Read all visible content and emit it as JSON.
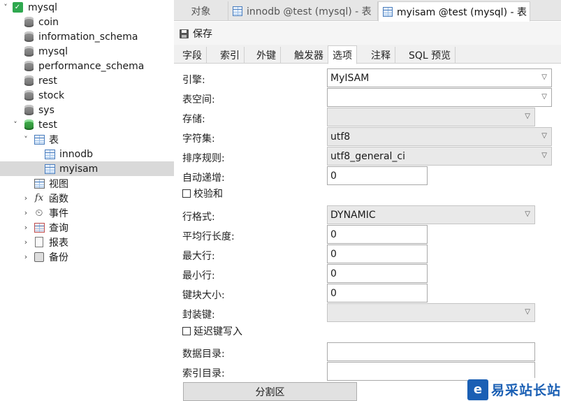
{
  "sidebar": {
    "root": {
      "label": "mysql"
    },
    "dbs": [
      "coin",
      "information_schema",
      "mysql",
      "performance_schema",
      "rest",
      "stock",
      "sys"
    ],
    "test": {
      "label": "test",
      "tables_label": "表",
      "tables": [
        "innodb",
        "myisam"
      ],
      "views_label": "视图",
      "functions_label": "函数",
      "events_label": "事件",
      "queries_label": "查询",
      "reports_label": "报表",
      "backups_label": "备份"
    }
  },
  "doc_tabs": [
    {
      "label": "对象"
    },
    {
      "label": "innodb @test (mysql) - 表"
    },
    {
      "label": "myisam @test (mysql) - 表"
    }
  ],
  "toolbar": {
    "save_label": "保存"
  },
  "sub_tabs": [
    "字段",
    "索引",
    "外键",
    "触发器",
    "选项",
    "注释",
    "SQL 预览"
  ],
  "form": {
    "engine_label": "引擎:",
    "engine_value": "MyISAM",
    "tablespace_label": "表空间:",
    "tablespace_value": "",
    "storage_label": "存储:",
    "storage_value": "",
    "charset_label": "字符集:",
    "charset_value": "utf8",
    "collation_label": "排序规则:",
    "collation_value": "utf8_general_ci",
    "auto_inc_label": "自动递增:",
    "auto_inc_value": "0",
    "checksum_label": "校验和",
    "row_format_label": "行格式:",
    "row_format_value": "DYNAMIC",
    "avg_row_label": "平均行长度:",
    "avg_row_value": "0",
    "max_rows_label": "最大行:",
    "max_rows_value": "0",
    "min_rows_label": "最小行:",
    "min_rows_value": "0",
    "key_block_label": "键块大小:",
    "key_block_value": "0",
    "pack_keys_label": "封装键:",
    "pack_keys_value": "",
    "delay_key_label": "延迟键写入",
    "data_dir_label": "数据目录:",
    "data_dir_value": "",
    "index_dir_label": "索引目录:",
    "index_dir_value": "",
    "partition_label": "分割区"
  },
  "watermark": {
    "brand": "易采站长站"
  }
}
